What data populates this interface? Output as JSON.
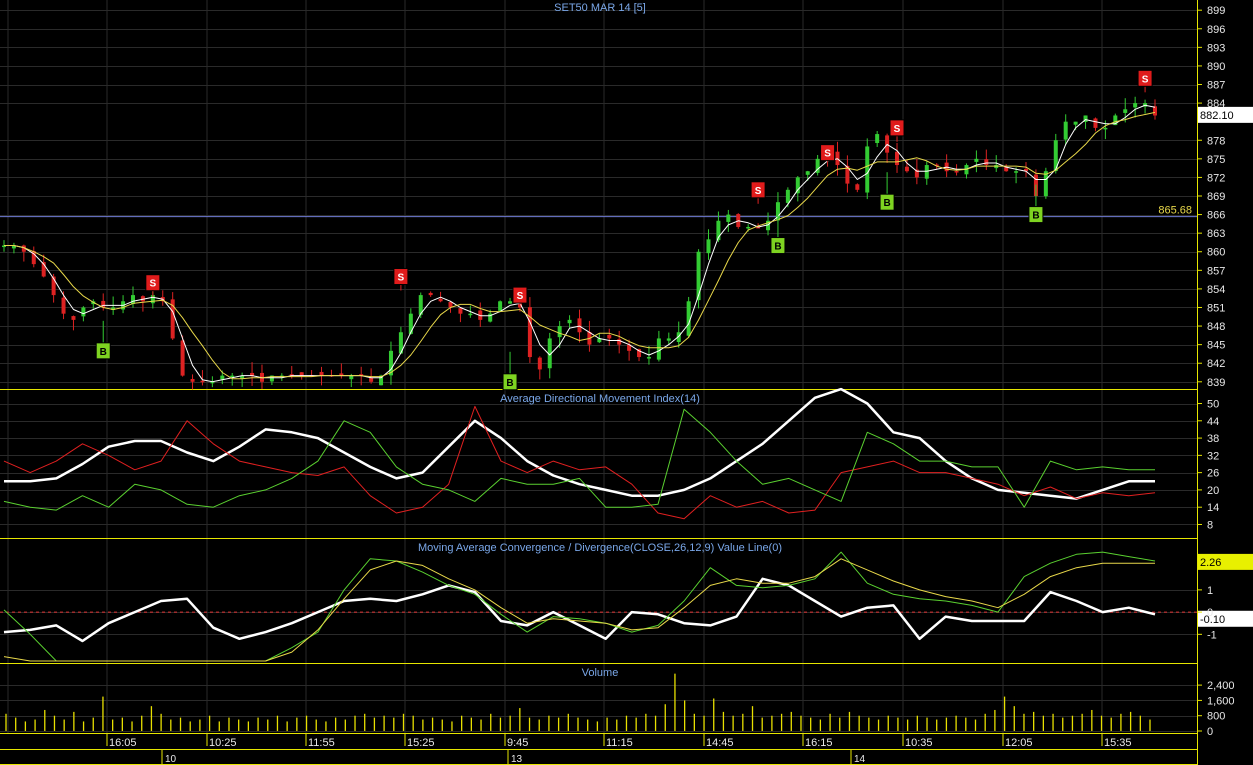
{
  "chart_data": [
    {
      "type": "candlestick",
      "title": "SET50 MAR 14",
      "interval": "[5]",
      "ylim": [
        838,
        900
      ],
      "yticks": [
        839,
        842,
        845,
        848,
        851,
        854,
        857,
        860,
        863,
        866,
        869,
        872,
        875,
        878,
        884,
        887,
        890,
        893,
        896,
        899
      ],
      "last_price": "882.10",
      "reference_line": {
        "value": 865.68,
        "label": "865.68"
      },
      "close_path": [
        861,
        861,
        860,
        858,
        856,
        853,
        850,
        849,
        851,
        852,
        851,
        851,
        852,
        853,
        852,
        853,
        852,
        846,
        840,
        839,
        839,
        839,
        840,
        840,
        840,
        840,
        839,
        840,
        840,
        840,
        840,
        840,
        840,
        840,
        840,
        840,
        840,
        839,
        840,
        844,
        847,
        850,
        853,
        853,
        852,
        851,
        850,
        850,
        849,
        850,
        852,
        852,
        851,
        843,
        841,
        846,
        848,
        849,
        847,
        845,
        846,
        846,
        845,
        844,
        843,
        843,
        846,
        846,
        847,
        852,
        860,
        862,
        865,
        866,
        864,
        864,
        864,
        865,
        868,
        870,
        872,
        873,
        875,
        876,
        874,
        871,
        870,
        877,
        879,
        876,
        874,
        873,
        872,
        874,
        874,
        873,
        873,
        874,
        875,
        874,
        874,
        873,
        873,
        873,
        869,
        873,
        878,
        881,
        881,
        882,
        880,
        880,
        882,
        883,
        884,
        884,
        882
      ],
      "signals": [
        {
          "label": "B",
          "x_index": 10,
          "price": 844
        },
        {
          "label": "S",
          "x_index": 15,
          "price": 855
        },
        {
          "label": "S",
          "x_index": 40,
          "price": 856
        },
        {
          "label": "S",
          "x_index": 52,
          "price": 853
        },
        {
          "label": "B",
          "x_index": 51,
          "price": 839
        },
        {
          "label": "B",
          "x_index": 78,
          "price": 861
        },
        {
          "label": "S",
          "x_index": 76,
          "price": 870
        },
        {
          "label": "S",
          "x_index": 83,
          "price": 876
        },
        {
          "label": "S",
          "x_index": 90,
          "price": 880
        },
        {
          "label": "B",
          "x_index": 89,
          "price": 868
        },
        {
          "label": "B",
          "x_index": 104,
          "price": 866
        },
        {
          "label": "S",
          "x_index": 115,
          "price": 888
        }
      ]
    },
    {
      "type": "line",
      "title": "Average Directional Movement Index(14)",
      "ylim": [
        4,
        54
      ],
      "yticks": [
        8,
        14,
        20,
        26,
        32,
        38,
        44,
        50
      ],
      "series": [
        {
          "color": "#ffffff",
          "values": [
            23,
            23,
            24,
            29,
            35,
            37,
            37,
            33,
            30,
            35,
            41,
            40,
            38,
            33,
            28,
            24,
            26,
            35,
            44,
            38,
            30,
            25,
            22,
            20,
            18,
            18,
            20,
            24,
            30,
            36,
            44,
            52,
            55,
            50,
            40,
            38,
            30,
            24,
            20,
            19,
            18,
            17,
            20,
            23,
            23
          ]
        },
        {
          "color": "#e02020",
          "values": [
            30,
            26,
            30,
            36,
            32,
            27,
            30,
            44,
            36,
            30,
            28,
            26,
            25,
            28,
            18,
            12,
            14,
            22,
            49,
            30,
            26,
            30,
            27,
            28,
            22,
            12,
            10,
            18,
            14,
            16,
            12,
            13,
            26,
            28,
            30,
            26,
            26,
            24,
            22,
            18,
            21,
            17,
            19,
            18,
            19
          ]
        },
        {
          "color": "#5ad030",
          "values": [
            16,
            14,
            13,
            18,
            14,
            22,
            20,
            15,
            14,
            18,
            20,
            24,
            30,
            44,
            40,
            28,
            22,
            20,
            16,
            24,
            22,
            22,
            24,
            14,
            14,
            15,
            48,
            40,
            30,
            22,
            24,
            20,
            16,
            40,
            36,
            30,
            30,
            28,
            28,
            14,
            30,
            27,
            28,
            27,
            27
          ]
        }
      ]
    },
    {
      "type": "line",
      "title": "Moving Average Convergence / Divergence(CLOSE,26,12,9) Value Line(0)",
      "ylim": [
        -2.2,
        3.2
      ],
      "yticks": [
        -1,
        0,
        1
      ],
      "zero_line": 0,
      "value_labels": [
        "2.26",
        "-0.10"
      ],
      "series": [
        {
          "color": "#ffffff",
          "values": [
            -0.9,
            -0.8,
            -0.6,
            -1.3,
            -0.5,
            0.0,
            0.5,
            0.6,
            -0.7,
            -1.2,
            -0.9,
            -0.5,
            0.0,
            0.5,
            0.6,
            0.5,
            0.8,
            1.2,
            0.9,
            -0.4,
            -0.6,
            0.0,
            -0.6,
            -1.2,
            0.0,
            -0.1,
            -0.5,
            -0.6,
            -0.2,
            1.5,
            1.2,
            0.5,
            -0.2,
            0.2,
            0.3,
            -1.2,
            -0.2,
            -0.4,
            -0.4,
            -0.4,
            0.9,
            0.5,
            0.0,
            0.2,
            -0.1
          ]
        },
        {
          "color": "#5ad030",
          "values": [
            0.1,
            -1.0,
            -2.6,
            -3.0,
            -2.8,
            -2.6,
            -2.2,
            -2.6,
            -2.7,
            -2.6,
            -2.2,
            -1.6,
            -0.9,
            1.0,
            2.4,
            2.3,
            1.8,
            1.2,
            0.8,
            -0.1,
            -0.9,
            -0.2,
            -0.3,
            -0.5,
            -0.9,
            -0.6,
            0.5,
            2.0,
            1.2,
            1.1,
            1.2,
            1.5,
            2.7,
            1.3,
            0.8,
            0.6,
            0.5,
            0.3,
            0.0,
            1.6,
            2.2,
            2.6,
            2.7,
            2.5,
            2.3
          ]
        },
        {
          "color": "#e8d84a",
          "values": [
            -2.0,
            -2.4,
            -2.6,
            -2.6,
            -2.6,
            -2.5,
            -2.5,
            -2.5,
            -2.5,
            -2.4,
            -2.2,
            -1.8,
            -0.8,
            0.6,
            1.9,
            2.3,
            2.1,
            1.5,
            1.0,
            0.2,
            -0.5,
            -0.3,
            -0.4,
            -0.5,
            -0.8,
            -0.7,
            0.2,
            1.2,
            1.5,
            1.3,
            1.3,
            1.6,
            2.4,
            1.9,
            1.4,
            1.0,
            0.7,
            0.5,
            0.2,
            0.8,
            1.6,
            2.0,
            2.2,
            2.2,
            2.2
          ]
        }
      ]
    },
    {
      "type": "bar",
      "title": "Volume",
      "ylim": [
        0,
        3400
      ],
      "ytick_labels": [
        "2,400",
        "1,600",
        "800",
        "0"
      ],
      "yticks": [
        2400,
        1600,
        800,
        0
      ],
      "values": [
        900,
        700,
        500,
        600,
        1100,
        800,
        600,
        1000,
        500,
        700,
        1800,
        600,
        700,
        500,
        800,
        1300,
        900,
        600,
        700,
        500,
        600,
        800,
        500,
        700,
        600,
        500,
        700,
        600,
        800,
        500,
        700,
        800,
        600,
        500,
        700,
        600,
        800,
        900,
        700,
        800,
        700,
        900,
        800,
        600,
        700,
        600,
        500,
        800,
        700,
        600,
        900,
        700,
        800,
        1200,
        700,
        600,
        800,
        700,
        900,
        700,
        600,
        500,
        700,
        600,
        800,
        700,
        900,
        800,
        1400,
        3000,
        1600,
        900,
        800,
        1700,
        1000,
        800,
        900,
        1300,
        700,
        800,
        900,
        1000,
        800,
        700,
        600,
        900,
        700,
        1000,
        800,
        700,
        600,
        800,
        700,
        600,
        800,
        700,
        600,
        700,
        800,
        700,
        600,
        900,
        1100,
        1800,
        1300,
        900,
        1000,
        800,
        900,
        700,
        800,
        900,
        1100,
        800,
        700,
        900,
        1000,
        800,
        600
      ]
    }
  ],
  "time_axis": {
    "times": [
      "16:05",
      "10:25",
      "11:55",
      "15:25",
      "9:45",
      "11:15",
      "14:45",
      "16:15",
      "10:35",
      "12:05",
      "15:35"
    ],
    "days": [
      "10",
      "13",
      "14"
    ]
  }
}
